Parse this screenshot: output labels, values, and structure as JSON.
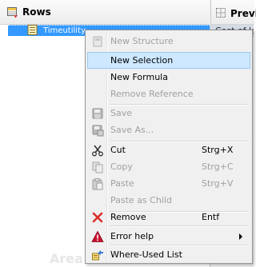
{
  "rows_panel": {
    "title": "Rows",
    "selected_item": "Timeutility"
  },
  "preview_panel": {
    "title": "Previ",
    "cell": "Cost of la"
  },
  "watermark": "Area",
  "menu": {
    "new_structure": "New Structure",
    "new_selection": "New Selection",
    "new_formula": "New Formula",
    "remove_reference": "Remove Reference",
    "save": "Save",
    "save_as": "Save As...",
    "cut": "Cut",
    "cut_shortcut": "Strg+X",
    "copy": "Copy",
    "copy_shortcut": "Strg+C",
    "paste": "Paste",
    "paste_shortcut": "Strg+V",
    "paste_as_child": "Paste as Child",
    "remove": "Remove",
    "remove_shortcut": "Entf",
    "error_help": "Error help",
    "where_used_list": "Where-Used List"
  },
  "colors": {
    "selection": "#3399ff",
    "menu_hover": "#cde8ff",
    "remove_icon": "#d9312b",
    "error_icon": "#c8102e"
  }
}
